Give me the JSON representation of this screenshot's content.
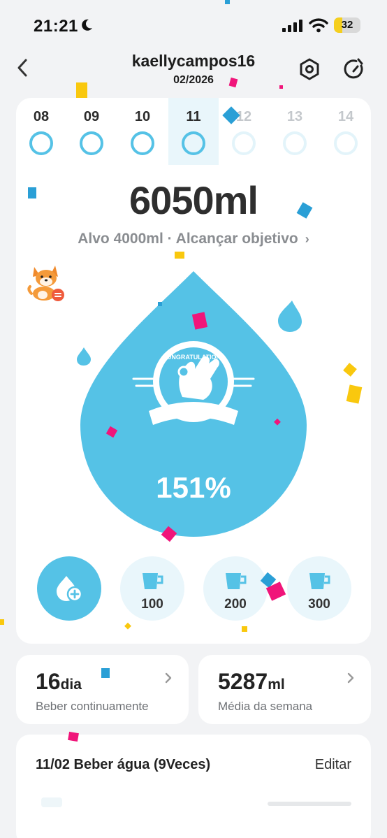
{
  "status_bar": {
    "time": "21:21",
    "battery": "32",
    "battery_level": 0.32
  },
  "header": {
    "title": "kaellycampos16",
    "date": "02/2026"
  },
  "days": [
    {
      "label": "08",
      "state": "done"
    },
    {
      "label": "09",
      "state": "done"
    },
    {
      "label": "10",
      "state": "done"
    },
    {
      "label": "11",
      "state": "selected"
    },
    {
      "label": "12",
      "state": "future"
    },
    {
      "label": "13",
      "state": "future"
    },
    {
      "label": "14",
      "state": "future"
    }
  ],
  "summary": {
    "amount": "6050ml",
    "goal_text": "Alvo 4000ml · Alcançar objetivo",
    "percent": "151%",
    "badge_text": "CONGRATULATIONS"
  },
  "quick_add": [
    {
      "label": "100"
    },
    {
      "label": "200"
    },
    {
      "label": "300"
    }
  ],
  "stats": {
    "streak_value": "16",
    "streak_unit": "dia",
    "streak_label": "Beber continuamente",
    "average_value": "5287",
    "average_unit": "ml",
    "average_label": "Média da semana"
  },
  "log": {
    "title": "11/02 Beber água (9Veces)",
    "edit_label": "Editar"
  },
  "colors": {
    "accent": "#55c2e6",
    "accent_light": "#e9f6fb",
    "confetti_pink": "#f0157a",
    "confetti_yellow": "#f9c80e",
    "confetti_blue": "#2a9fd6"
  },
  "icons": [
    "moon-icon",
    "signal-icon",
    "wifi-icon",
    "back-chevron-icon",
    "settings-hexagon-icon",
    "refresh-icon",
    "pet-dog-icon",
    "water-drop-icon",
    "congratulations-badge-icon",
    "drop-plus-icon",
    "cup-icon",
    "chevron-right-icon"
  ]
}
